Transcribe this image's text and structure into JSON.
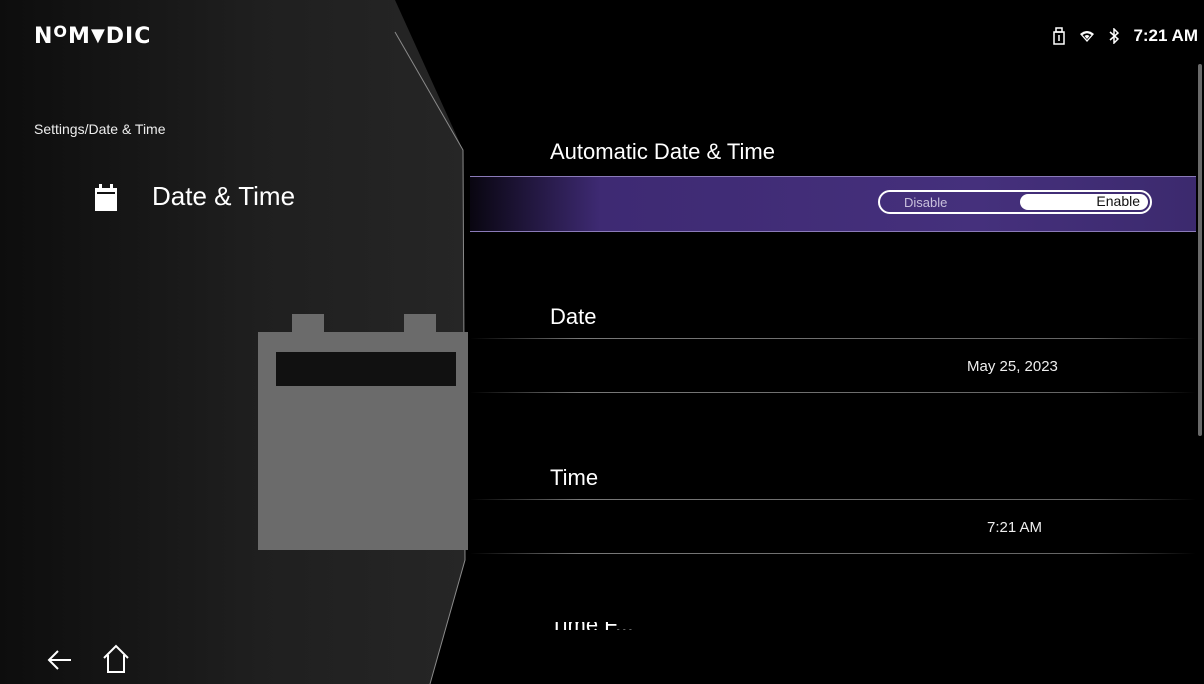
{
  "brand": {
    "logo_text": "NOMVDIC",
    "accent": "#7b4bd6"
  },
  "status_bar": {
    "icons": [
      "usb-icon",
      "wifi-icon",
      "bluetooth-icon"
    ],
    "clock": "7:21 AM"
  },
  "sidebar": {
    "breadcrumb": "Settings/Date & Time",
    "section_title": "Date & Time",
    "section_icon": "calendar-icon"
  },
  "settings": {
    "automatic": {
      "title": "Automatic Date & Time",
      "options": [
        "Disable",
        "Enable"
      ],
      "selected": "Enable"
    },
    "date": {
      "title": "Date",
      "value": "May 25, 2023"
    },
    "time": {
      "title": "Time",
      "value": "7:21 AM"
    },
    "next_partial": {
      "title": "Time F..."
    }
  },
  "nav": {
    "back_icon": "back-arrow-icon",
    "home_icon": "home-icon"
  },
  "colors": {
    "selection": "#45307c",
    "background": "#000000"
  }
}
